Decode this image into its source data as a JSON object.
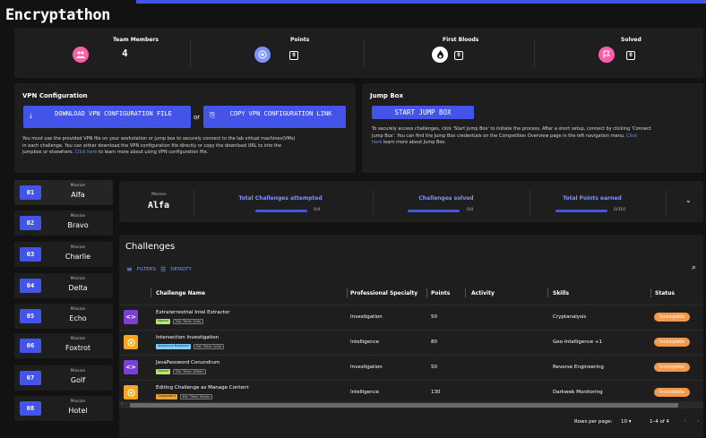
{
  "app": {
    "title": "Encryptathon"
  },
  "stats": [
    {
      "label": "Team Members",
      "value": "4",
      "icon": "people-icon",
      "color": "#ff5fa8"
    },
    {
      "label": "Points",
      "value": "0",
      "icon": "target-icon",
      "color": "#7f93ff"
    },
    {
      "label": "First Bloods",
      "value": "0",
      "icon": "flame-icon",
      "color": "#ffffff"
    },
    {
      "label": "Solved",
      "value": "0",
      "icon": "flag-icon",
      "color": "#ff5fa8"
    }
  ],
  "vpn": {
    "title": "VPN Configuration",
    "download_label": "DOWNLOAD VPN CONFIGURATION FILE",
    "or": "or",
    "copy_label": "COPY VPN CONFIGURATION LINK",
    "desc_line1": "You must use the provided VPN file on your workstation or jump box to securely connect to the lab virtual machines(VMs)",
    "desc_line2": "in each challenge. You can either download the VPN configuration file directly or copy the download URL to into the",
    "desc_line3_pre": "jumpbox or elsewhere.",
    "desc_link": "Click here",
    "desc_line3_post": "to learn more about using VPN configuration file."
  },
  "jump": {
    "title": "Jump Box",
    "button_label": "START JUMP BOX",
    "desc_line1": "To securely access challenges, click 'Start Jump Box' to initiate the process. After a short setup, connect by clicking 'Connect",
    "desc_line2": "Jump Box'. You can find the Jump Box credentials on the Competition Overview page in the left navigation menu.",
    "desc_link_a": "Click",
    "desc_link_b": "here",
    "desc_line3_post": "learn more about Jump Box."
  },
  "missions": [
    {
      "num": "01",
      "label": "Mission",
      "name": "Alfa"
    },
    {
      "num": "02",
      "label": "Mission",
      "name": "Bravo"
    },
    {
      "num": "03",
      "label": "Mission",
      "name": "Charlie"
    },
    {
      "num": "04",
      "label": "Mission",
      "name": "Delta"
    },
    {
      "num": "05",
      "label": "Mission",
      "name": "Echo"
    },
    {
      "num": "06",
      "label": "Mission",
      "name": "Foxtrot"
    },
    {
      "num": "07",
      "label": "Mission",
      "name": "Golf"
    },
    {
      "num": "08",
      "label": "Mission",
      "name": "Hotel"
    }
  ],
  "progress": {
    "mission_label": "Mission",
    "mission_name": "Alfa",
    "attempted_label": "Total Challenges attempted",
    "attempted_value": "0/4",
    "attempted_fraction": 0,
    "solved_label": "Challenges solved",
    "solved_value": "0/4",
    "solved_fraction": 0,
    "points_label": "Total Points earned",
    "points_value": "0/310",
    "points_fraction": 0
  },
  "challenges": {
    "title": "Challenges",
    "filters_label": "FILTERS",
    "density_label": "DENSITY",
    "columns": [
      "Challenge Name",
      "Professional Specialty",
      "Points",
      "Activity",
      "Skills",
      "Status"
    ],
    "rows": [
      {
        "name": "Extraterrestrial Intel Extractor",
        "level": "Novice",
        "time": "Est. Time: 1min",
        "specialty": "Investigation",
        "points": "50",
        "skills": "Cryptanalysis",
        "status": "Incomplete",
        "icon": "code-icon",
        "icon_color": "#7b3fd6"
      },
      {
        "name": "Intersection Investigation",
        "level": "Advanced Beginner",
        "time": "Est. Time: 1min",
        "specialty": "Intelligence",
        "points": "80",
        "skills": "Geo-Intelligence +1",
        "status": "Incomplete",
        "icon": "target-icon",
        "icon_color": "#f5a623"
      },
      {
        "name": "JavaPassword Conundrum",
        "level": "Novice",
        "time": "Est. Time: 20min",
        "specialty": "Investigation",
        "points": "50",
        "skills": "Reverse Engineering",
        "status": "Incomplete",
        "icon": "code-icon",
        "icon_color": "#7b3fd6"
      },
      {
        "name": "Editing Challenge as Manage Content",
        "level": "Competent",
        "time": "Est. Time: 50min",
        "specialty": "Intelligence",
        "points": "130",
        "skills": "Darkweb Monitoring",
        "status": "Incomplete",
        "icon": "target-icon",
        "icon_color": "#f5a623"
      }
    ],
    "rows_per_page_label": "Rows per page:",
    "rows_per_page": "10",
    "range": "1–4 of 4"
  }
}
